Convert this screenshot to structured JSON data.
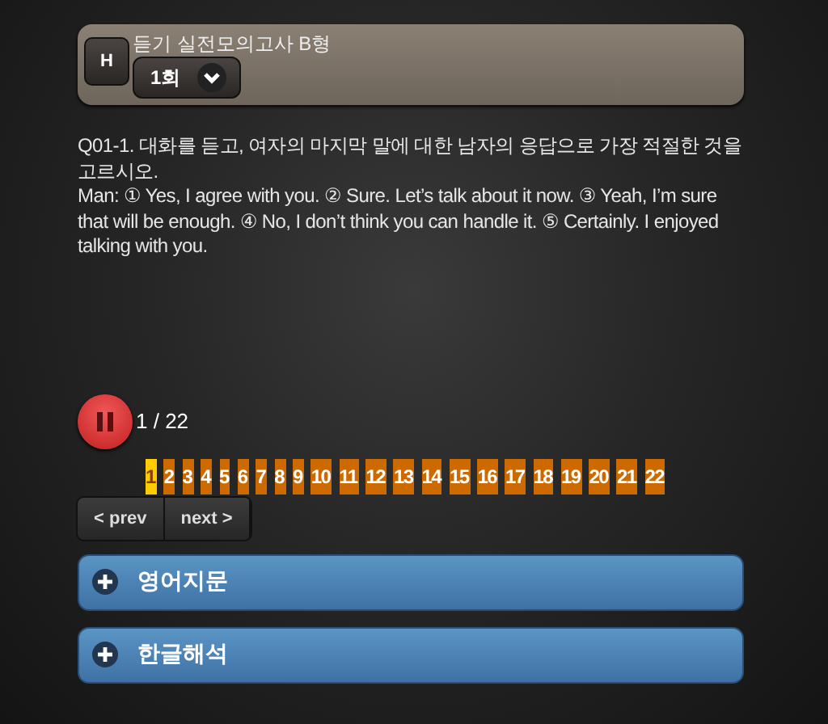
{
  "header": {
    "badge": "H",
    "title": "듣기 실전모의고사 B형",
    "round": "1회"
  },
  "question": {
    "prompt": "Q01-1. 대화를 듣고, 여자의 마지막 말에 대한 남자의 응답으로 가장 적절한 것을 고르시오.",
    "body": "Man: ① Yes, I agree with you. ② Sure. Let’s talk about it now. ③ Yeah, I’m sure that will be enough. ④ No, I don’t think you can handle it. ⑤ Certainly. I enjoyed talking with you."
  },
  "player": {
    "playing": true,
    "counter": "1 / 22"
  },
  "pages": [
    {
      "label": "1",
      "selected": true
    },
    {
      "label": "2",
      "selected": false
    },
    {
      "label": "3",
      "selected": false
    },
    {
      "label": "4",
      "selected": false
    },
    {
      "label": "5",
      "selected": false
    },
    {
      "label": "6",
      "selected": false
    },
    {
      "label": "7",
      "selected": false
    },
    {
      "label": "8",
      "selected": false
    },
    {
      "label": "9",
      "selected": false
    },
    {
      "label": "10",
      "selected": false
    },
    {
      "label": "11",
      "selected": false
    },
    {
      "label": "12",
      "selected": false
    },
    {
      "label": "13",
      "selected": false
    },
    {
      "label": "14",
      "selected": false
    },
    {
      "label": "15",
      "selected": false
    },
    {
      "label": "16",
      "selected": false
    },
    {
      "label": "17",
      "selected": false
    },
    {
      "label": "18",
      "selected": false
    },
    {
      "label": "19",
      "selected": false
    },
    {
      "label": "20",
      "selected": false
    },
    {
      "label": "21",
      "selected": false
    },
    {
      "label": "22",
      "selected": false
    }
  ],
  "pager": {
    "prev": "< prev",
    "next": "next >"
  },
  "sections": [
    {
      "label": "영어지문",
      "expanded": false
    },
    {
      "label": "한글해석",
      "expanded": false
    }
  ]
}
